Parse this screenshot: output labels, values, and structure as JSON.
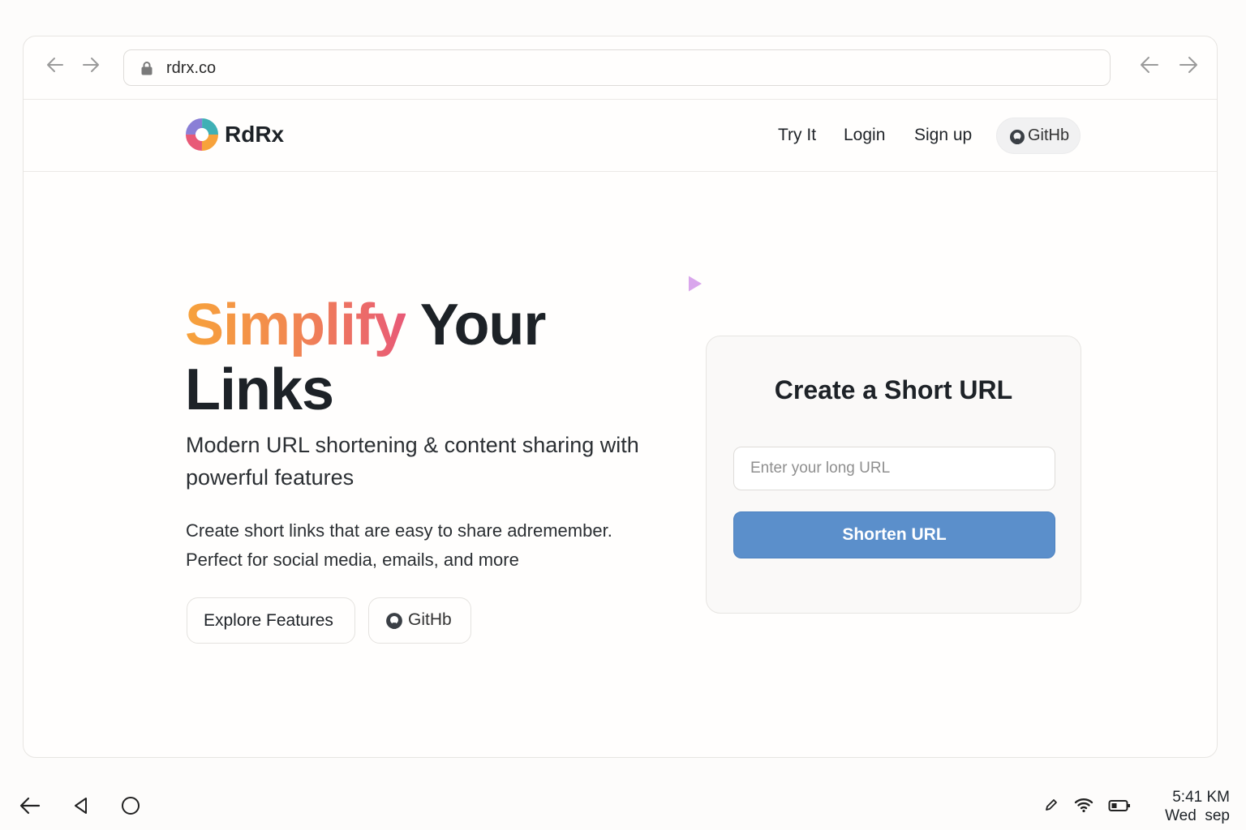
{
  "browser": {
    "url": "rdrx.co",
    "back_icon": "arrow-left-icon",
    "forward_icon": "arrow-right-icon"
  },
  "header": {
    "brand": "RdRx",
    "nav": [
      "Try It",
      "Login",
      "Sign up"
    ],
    "github_label": "GitHb"
  },
  "hero": {
    "title_highlight": "Simplify",
    "title_rest_line1": "Your",
    "title_line2": "Links",
    "subtitle": "Modern URL shortening & content sharing with powerful features",
    "description": "Create short links that are easy to share adremember. Perfect for social media, emails, and more",
    "explore_button": "Explore Features",
    "github_button": "GitHb"
  },
  "card": {
    "title": "Create a Short URL",
    "input_placeholder": "Enter your long URL",
    "input_value": "",
    "button_label": "Shorten URL"
  },
  "taskbar": {
    "time": "5:41 KM",
    "date": "Wed  sep"
  },
  "colors": {
    "accent": "#5b8fcb",
    "gradient_start": "#f7a23b",
    "gradient_end": "#e85a77",
    "text": "#1d2227"
  }
}
